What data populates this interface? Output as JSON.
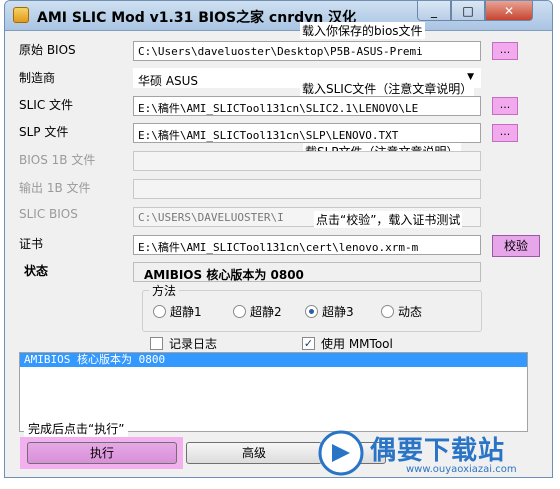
{
  "window": {
    "title": "AMI SLIC Mod v1.31  BIOS之家 cnrdyn 汉化",
    "close_label": "✕"
  },
  "fields": {
    "bios_label": "原始 BIOS",
    "bios_value": "C:\\Users\\daveluoster\\Desktop\\P5B-ASUS-Premi",
    "manufacturer_label": "制造商",
    "manufacturer_value": "华硕 ASUS",
    "slic_label": "SLIC 文件",
    "slic_value": "E:\\稿件\\AMI_SLICTool131cn\\SLIC2.1\\LENOVO\\LE",
    "slp_label": "SLP 文件",
    "slp_value": "E:\\稿件\\AMI_SLICTool131cn\\SLP\\LENOVO.TXT",
    "bios1b_label": "BIOS 1B 文件",
    "output1b_label": "输出 1B 文件",
    "slic_bios_label": "SLIC BIOS",
    "slic_bios_value": "C:\\USERS\\DAVELUOSTER\\I",
    "cert_label": "证书",
    "cert_value": "E:\\稿件\\AMI_SLICTool131cn\\cert\\lenovo.xrm-m",
    "status_label": "状态",
    "status_value": "AMIBIOS 核心版本为 0800"
  },
  "buttons": {
    "browse": "...",
    "verify": "校验",
    "execute": "执行",
    "advanced": "高级"
  },
  "callouts": {
    "bios": "载入你保存的bios文件",
    "slic": "载入SLIC文件（注意文章说明）",
    "slp": "载SLP文件（注意文章说明）",
    "cert": "点击“校验”，载入证书测试",
    "execute": "完成后点击“执行”"
  },
  "method": {
    "title": "方法",
    "options": [
      "超静1",
      "超静2",
      "超静3",
      "动态"
    ],
    "selected": "超静3"
  },
  "options": {
    "log_label": "记录日志",
    "log_checked": false,
    "mmtool_label": "使用 MMTool",
    "mmtool_checked": true
  },
  "log": {
    "lines": [
      "AMIBIOS 核心版本为 0800"
    ]
  },
  "watermark": {
    "title": "偶要下载站",
    "url": "www.ouyaoxiazai.com"
  },
  "colors": {
    "highlight_pink": "#f2a9ee",
    "selection_blue": "#3399ff",
    "watermark_blue": "#2a74c6"
  }
}
